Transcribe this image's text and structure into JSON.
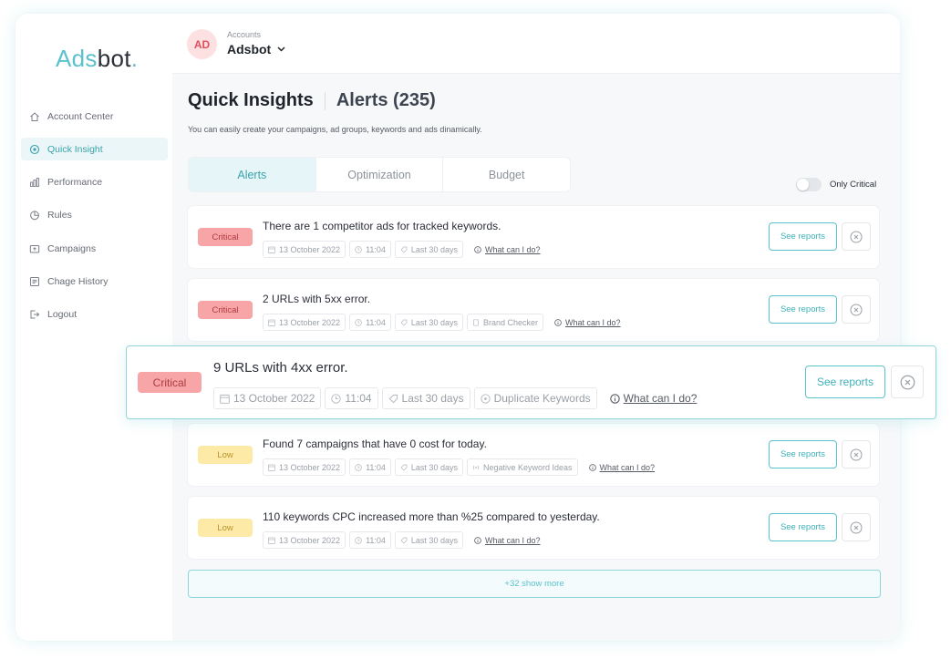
{
  "brand": {
    "logo_part1": "Ads",
    "logo_part2": "bot",
    "logo_dot": "."
  },
  "sidebar": {
    "items": [
      {
        "label": "Account Center",
        "icon": "home-icon",
        "active": false
      },
      {
        "label": "Quick Insight",
        "icon": "insight-icon",
        "active": true
      },
      {
        "label": "Performance",
        "icon": "bar-chart-icon",
        "active": false
      },
      {
        "label": "Rules",
        "icon": "pie-chart-icon",
        "active": false
      },
      {
        "label": "Campaigns",
        "icon": "campaign-icon",
        "active": false
      },
      {
        "label": "Chage History",
        "icon": "history-icon",
        "active": false
      },
      {
        "label": "Logout",
        "icon": "logout-icon",
        "active": false
      }
    ]
  },
  "account": {
    "avatar": "AD",
    "label": "Accounts",
    "name": "Adsbot"
  },
  "page": {
    "title": "Quick Insights",
    "subtitle_title": "Alerts (235)",
    "description": "You can easily create your campaigns, ad groups, keywords and ads dinamically."
  },
  "tabs": [
    {
      "label": "Alerts",
      "active": true
    },
    {
      "label": "Optimization",
      "active": false
    },
    {
      "label": "Budget",
      "active": false
    }
  ],
  "filter": {
    "only_critical_label": "Only Critical",
    "only_critical_on": false
  },
  "alerts": [
    {
      "severity": "Critical",
      "title": "There are 1 competitor ads for tracked keywords.",
      "date": "13 October 2022",
      "time": "11:04",
      "range": "Last 30 days",
      "tool": "",
      "help": "What can I do?"
    },
    {
      "severity": "Critical",
      "title": "2 URLs with 5xx error.",
      "date": "13 October 2022",
      "time": "11:04",
      "range": "Last 30 days",
      "tool": "Brand Checker",
      "help": "What can I do?"
    },
    {
      "severity": "Critical",
      "title": "9 URLs with 4xx error.",
      "date": "13 October 2022",
      "time": "11:04",
      "range": "Last 30 days",
      "tool": "Duplicate Keywords",
      "help": "What can I do?"
    },
    {
      "severity": "Low",
      "title": "Found 7 campaigns that have 0 cost for today.",
      "date": "13 October 2022",
      "time": "11:04",
      "range": "Last 30 days",
      "tool": "Negative Keyword Ideas",
      "help": "What can I do?"
    },
    {
      "severity": "Low",
      "title": "110 keywords CPC increased more than %25 compared to yesterday.",
      "date": "13 October 2022",
      "time": "11:04",
      "range": "Last 30 days",
      "tool": "",
      "help": "What can I do?"
    }
  ],
  "actions": {
    "see_reports": "See reports",
    "show_more": "+32 show more"
  },
  "colors": {
    "accent": "#5ac2cc",
    "critical": "#f8a5a7",
    "low": "#fdeaa6"
  }
}
